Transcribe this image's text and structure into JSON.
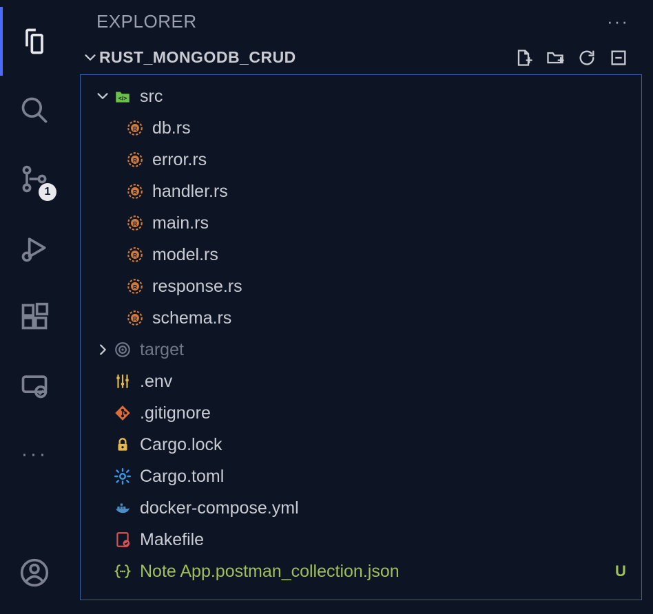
{
  "activityBar": {
    "sourceControlBadge": "1"
  },
  "explorer": {
    "title": "EXPLORER",
    "moreGlyph": "···",
    "section": {
      "name": "RUST_MONGODB_CRUD"
    },
    "tree": {
      "src": {
        "name": "src",
        "files": {
          "db": "db.rs",
          "error": "error.rs",
          "handler": "handler.rs",
          "main": "main.rs",
          "model": "model.rs",
          "response": "response.rs",
          "schema": "schema.rs"
        }
      },
      "target": {
        "name": "target"
      },
      "env": ".env",
      "gitignore": ".gitignore",
      "cargolock": "Cargo.lock",
      "cargotoml": "Cargo.toml",
      "dockercompose": "docker-compose.yml",
      "makefile": "Makefile",
      "postman": {
        "name": "Note App.postman_collection.json",
        "status": "U"
      }
    }
  }
}
